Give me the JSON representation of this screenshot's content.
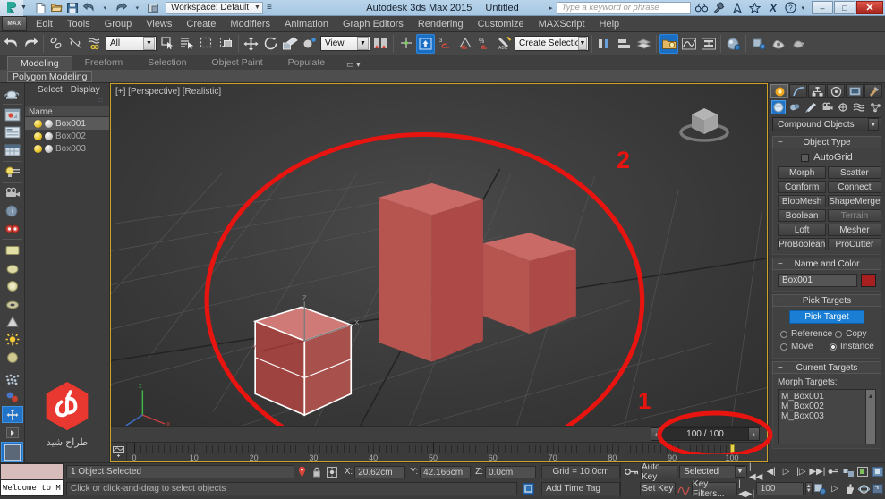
{
  "titlebar": {
    "workspace": "Workspace: Default",
    "app_title": "Autodesk 3ds Max  2015",
    "document": "Untitled",
    "search_placeholder": "Type a keyword or phrase",
    "qat": [
      "new-icon",
      "open-icon",
      "save-icon",
      "undo-icon",
      "redo-icon",
      "project-folder-icon"
    ],
    "right_icons": [
      "binoculars-icon",
      "wrench-icon",
      "compass-icon",
      "star-icon",
      "x-icon",
      "help-icon"
    ],
    "window_buttons": {
      "minimize": "–",
      "maximize": "□",
      "close": "✕"
    }
  },
  "menubar": {
    "max_button": "MAX",
    "items": [
      "Edit",
      "Tools",
      "Group",
      "Views",
      "Create",
      "Modifiers",
      "Animation",
      "Graph Editors",
      "Rendering",
      "Customize",
      "MAXScript",
      "Help"
    ]
  },
  "toolbar": {
    "selection_filter": "All",
    "reference_coord": "View",
    "named_selection_set": "Create Selection Se"
  },
  "ribbon": {
    "tabs": [
      "Modeling",
      "Freeform",
      "Selection",
      "Object Paint",
      "Populate"
    ],
    "active_tab": "Modeling",
    "panel": "Polygon Modeling"
  },
  "explorer": {
    "menus": [
      "Select",
      "Display"
    ],
    "column_header": "Name",
    "rows": [
      {
        "name": "Box001",
        "selected": true
      },
      {
        "name": "Box002",
        "selected": false
      },
      {
        "name": "Box003",
        "selected": false
      }
    ]
  },
  "logo": {
    "caption": "طراح شید",
    "color": "#e8382f"
  },
  "viewport": {
    "label": "[+] [Perspective] [Realistic]",
    "objects": [
      {
        "name": "Box001",
        "selected": true
      },
      {
        "name": "Box002",
        "selected": false
      },
      {
        "name": "Box003",
        "selected": false
      }
    ],
    "object_color": "#c05a5a",
    "nav_widget": "viewcube-icon"
  },
  "annotations": [
    {
      "label": "1",
      "shape": "ellipse",
      "target": "time-field"
    },
    {
      "label": "2",
      "shape": "circle",
      "target": "viewport-objects"
    }
  ],
  "timeslider": {
    "value": "100 / 100",
    "prev": "‹",
    "next": "›",
    "ruler_start": 0,
    "ruler_end": 100,
    "ruler_labels": [
      "0",
      "10",
      "20",
      "30",
      "40",
      "50",
      "60",
      "70",
      "80",
      "90",
      "100"
    ],
    "current_frame": 100
  },
  "command_panel": {
    "tabs": [
      "create-tab",
      "modify-tab",
      "hierarchy-tab",
      "motion-tab",
      "display-tab",
      "utilities-tab"
    ],
    "active_tab_index": 0,
    "categories": [
      "geometry-icon",
      "shapes-icon",
      "lights-icon",
      "cameras-icon",
      "helpers-icon",
      "space-warps-icon",
      "systems-icon"
    ],
    "category_dropdown": "Compound Objects",
    "object_type": {
      "title": "Object Type",
      "autogrid_label": "AutoGrid",
      "autogrid_checked": false,
      "buttons": [
        "Morph",
        "Scatter",
        "Conform",
        "Connect",
        "BlobMesh",
        "ShapeMerge",
        "Boolean",
        "Terrain",
        "Loft",
        "Mesher",
        "ProBoolean",
        "ProCutter"
      ]
    },
    "name_and_color": {
      "title": "Name and Color",
      "name": "Box001",
      "color": "#a81f1f"
    },
    "pick_targets": {
      "title": "Pick Targets",
      "button": "Pick Target",
      "options": [
        "Reference",
        "Copy",
        "Move",
        "Instance"
      ],
      "selected": "Instance"
    },
    "current_targets": {
      "title": "Current Targets",
      "list_label": "Morph Targets:",
      "items": [
        "M_Box001",
        "M_Box002",
        "M_Box003"
      ]
    }
  },
  "statusbar": {
    "maxscript_listener": "Welcome to M",
    "selection_status": "1 Object Selected",
    "prompt": "Click or click-and-drag to select objects",
    "coords": [
      {
        "axis": "X:",
        "value": "20.62cm"
      },
      {
        "axis": "Y:",
        "value": "42.166cm"
      },
      {
        "axis": "Z:",
        "value": "0.0cm"
      }
    ],
    "grid": "Grid = 10.0cm",
    "time_tag": "Add Time Tag"
  },
  "animation": {
    "auto_key": "Auto Key",
    "set_key": "Set Key",
    "key_mode": "Selected",
    "key_filters": "Key Filters...",
    "current_frame": "100",
    "playback_icons": [
      "go-to-start-icon",
      "previous-frame-icon",
      "play-icon",
      "next-frame-icon",
      "go-to-end-icon",
      "key-mode-icon",
      "time-config-icon"
    ],
    "nav_icons": [
      "zoom-icon",
      "zoom-all-icon",
      "zoom-extents-icon",
      "field-of-view-icon",
      "pan-icon",
      "orbit-icon",
      "maximize-viewport-icon"
    ]
  }
}
